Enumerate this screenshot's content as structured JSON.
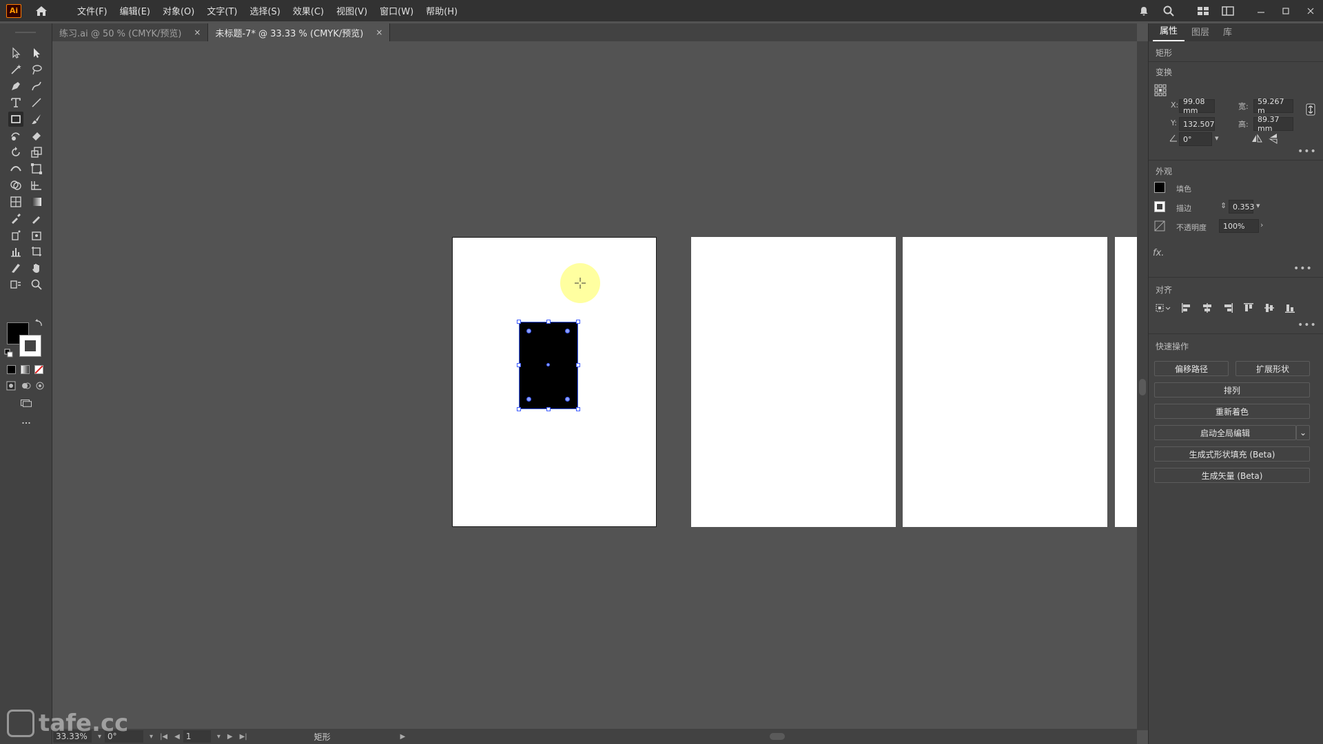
{
  "app": {
    "logo_text": "Ai"
  },
  "menu": [
    "文件(F)",
    "编辑(E)",
    "对象(O)",
    "文字(T)",
    "选择(S)",
    "效果(C)",
    "视图(V)",
    "窗口(W)",
    "帮助(H)"
  ],
  "tabs": [
    {
      "label": "练习.ai @ 50 % (CMYK/预览)",
      "close": "×"
    },
    {
      "label": "未标题-7* @ 33.33 % (CMYK/预览)",
      "close": "×"
    }
  ],
  "status": {
    "zoom": "33.33%",
    "rotation": "0°",
    "artboard_number": "1",
    "selection_type": "矩形"
  },
  "watermark": "tafe.cc",
  "panel": {
    "tabs": [
      "属性",
      "图层",
      "库"
    ],
    "object_type": "矩形",
    "transform": {
      "title": "变换",
      "x_label": "X:",
      "x": "99.08 mm",
      "y_label": "Y:",
      "y": "132.507",
      "w_label": "宽:",
      "w": "59.267 m",
      "h_label": "高:",
      "h": "89.37 mm",
      "angle": "0°"
    },
    "appearance": {
      "title": "外观",
      "fill_label": "填色",
      "stroke_label": "描边",
      "stroke_value": "0.353",
      "opacity_label": "不透明度",
      "opacity_value": "100%",
      "fx": "fx."
    },
    "align": {
      "title": "对齐"
    },
    "quick_actions": {
      "title": "快速操作",
      "offset_path": "偏移路径",
      "expand_shape": "扩展形状",
      "arrange": "排列",
      "recolor": "重新着色",
      "global_edit": "启动全局编辑",
      "gen_shape_fill": "生成式形状填充 (Beta)",
      "gen_vector": "生成矢量 (Beta)"
    }
  },
  "colors": {
    "accent_selection": "#3c5bff",
    "cursor_highlight": "#ffff96",
    "canvas_bg": "#535353",
    "panel_bg": "#424242"
  }
}
